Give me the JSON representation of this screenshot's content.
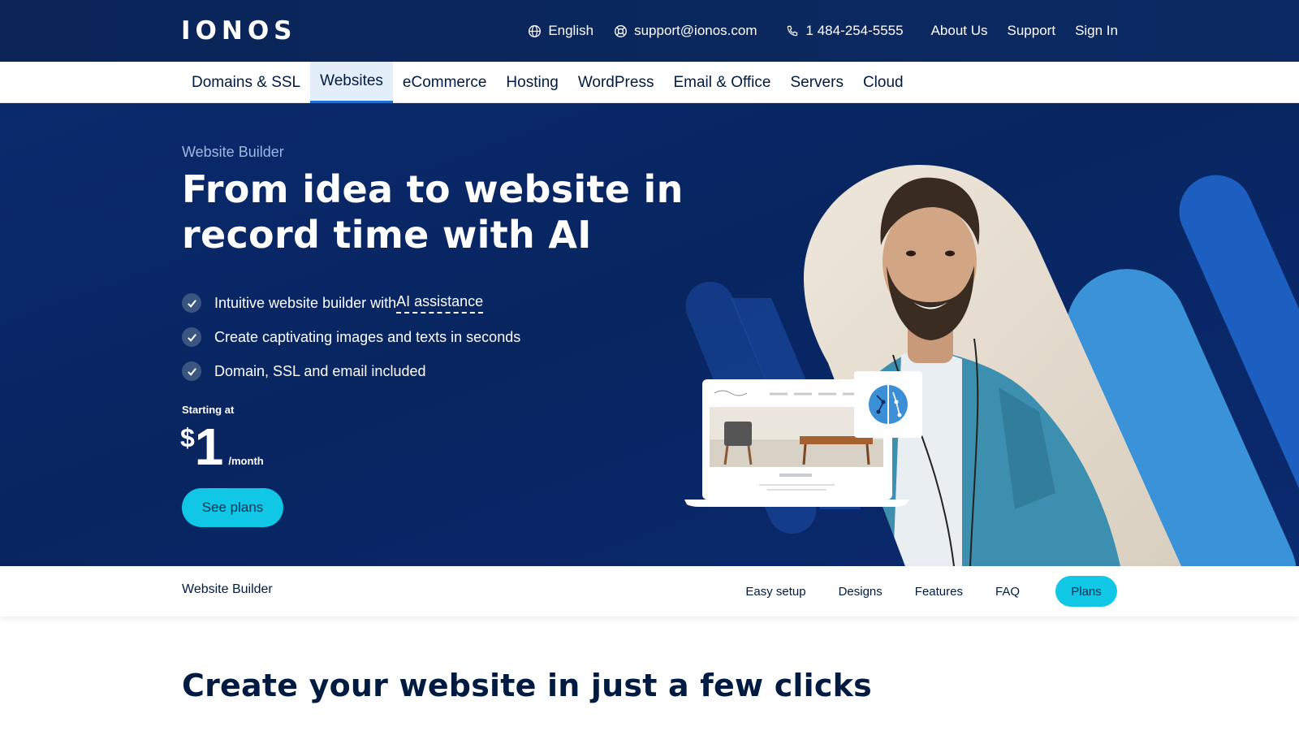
{
  "brand": {
    "logo": "IONOS"
  },
  "topbar": {
    "language": "English",
    "email": "support@ionos.com",
    "phone": "1 484-254-5555",
    "about": "About Us",
    "support": "Support",
    "signin": "Sign In"
  },
  "nav": {
    "items": [
      {
        "label": "Domains & SSL"
      },
      {
        "label": "Websites",
        "active": true
      },
      {
        "label": "eCommerce"
      },
      {
        "label": "Hosting"
      },
      {
        "label": "WordPress"
      },
      {
        "label": "Email & Office"
      },
      {
        "label": "Servers"
      },
      {
        "label": "Cloud"
      }
    ]
  },
  "hero": {
    "eyebrow": "Website Builder",
    "title": "From idea to website in record time with AI",
    "features": [
      {
        "prefix": "Intuitive website builder with ",
        "link": "AI assistance"
      },
      {
        "prefix": "Create captivating images and texts in seconds",
        "link": ""
      },
      {
        "prefix": "Domain, SSL and email included",
        "link": ""
      }
    ],
    "starting_label": "Starting at",
    "price_currency": "$",
    "price_amount": "1",
    "price_period": "/month",
    "cta": "See plans"
  },
  "subnav": {
    "title": "Website Builder",
    "links": [
      "Easy setup",
      "Designs",
      "Features",
      "FAQ"
    ],
    "button": "Plans"
  },
  "section": {
    "title": "Create your website in just a few clicks"
  },
  "colors": {
    "topbar": "#0b2a63",
    "hero": "#082560",
    "accent_cyan": "#11c7e6",
    "nav_active": "#1f6fd0"
  }
}
